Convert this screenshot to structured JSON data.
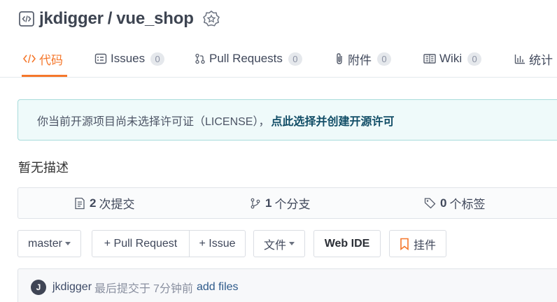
{
  "repo": {
    "owner": "jkdigger",
    "separator": "/",
    "name": "vue_shop"
  },
  "tabs": [
    {
      "label": "代码",
      "icon": "code-icon",
      "count": null,
      "active": true
    },
    {
      "label": "Issues",
      "icon": "issues-icon",
      "count": "0"
    },
    {
      "label": "Pull Requests",
      "icon": "pull-request-icon",
      "count": "0"
    },
    {
      "label": "附件",
      "icon": "paperclip-icon",
      "count": "0"
    },
    {
      "label": "Wiki",
      "icon": "book-icon",
      "count": "0"
    },
    {
      "label": "统计",
      "icon": "bar-chart-icon",
      "count": null
    }
  ],
  "license_notice": {
    "text": "你当前开源项目尚未选择许可证（LICENSE），",
    "link": "点此选择并创建开源许可"
  },
  "description": "暂无描述",
  "stats": {
    "commits_count": "2",
    "commits_label": "次提交",
    "branches_count": "1",
    "branches_label": "个分支",
    "tags_count": "0",
    "tags_label": "个标签"
  },
  "toolbar": {
    "branch": "master",
    "pull_request": "+ Pull Request",
    "issue": "+ Issue",
    "files": "文件",
    "web_ide": "Web IDE",
    "plugins": "挂件"
  },
  "last_commit": {
    "avatar_letter": "J",
    "author": "jkdigger",
    "text": "最后提交于",
    "time": "7分钟前",
    "message": "add files"
  },
  "colors": {
    "accent": "#f5772b",
    "notice_bg": "#effafa",
    "notice_border": "#a8dcdb",
    "link": "#124e67"
  }
}
